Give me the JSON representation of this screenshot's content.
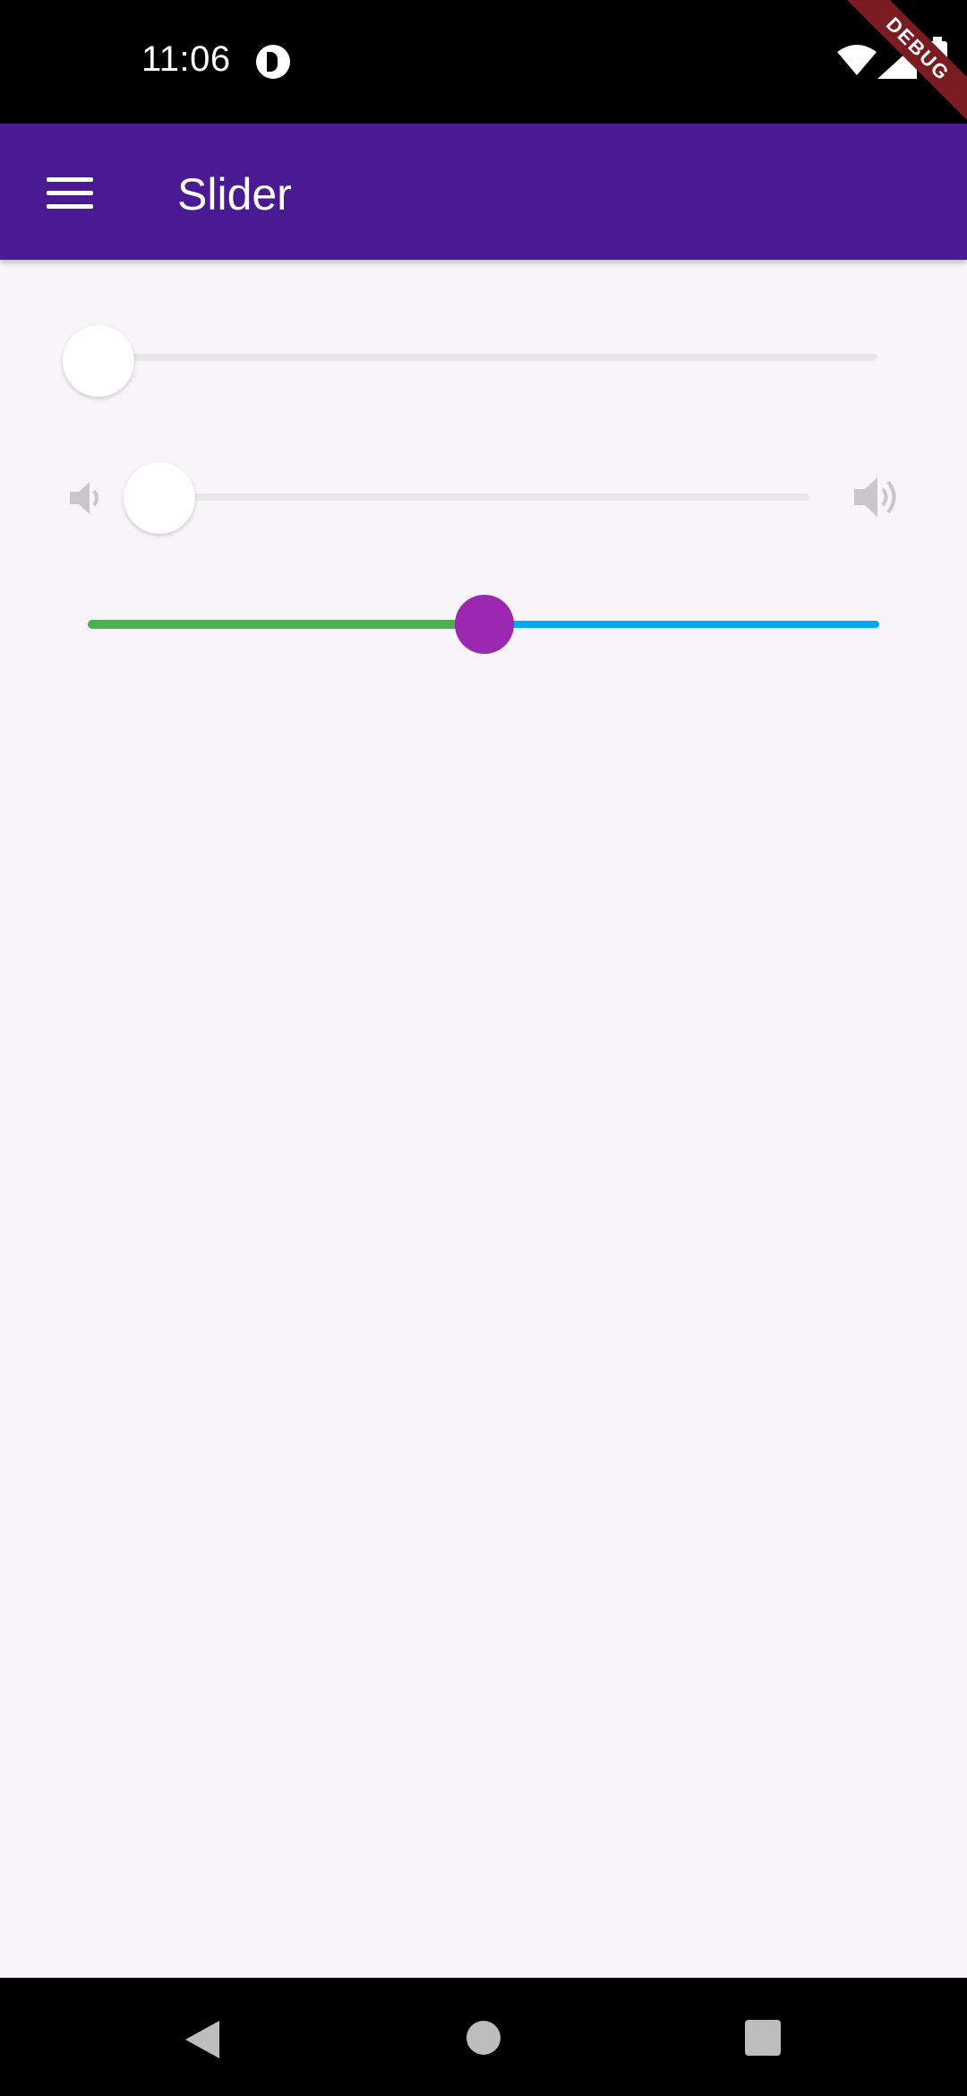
{
  "status_bar": {
    "time": "11:06",
    "debug_label": "DEBUG",
    "icons": [
      "app-notification-icon",
      "wifi-icon",
      "signal-icon",
      "battery-icon"
    ]
  },
  "app_bar": {
    "title": "Slider",
    "menu_icon": "menu-icon",
    "color": "#4a1a93"
  },
  "sliders": [
    {
      "name": "basic-slider",
      "value": 0.0,
      "min": 0,
      "max": 1
    },
    {
      "name": "volume-slider",
      "value": 0.0,
      "min": 0,
      "max": 1,
      "leading_icon": "volume-down-icon",
      "trailing_icon": "volume-up-icon"
    },
    {
      "name": "custom-slider",
      "value": 0.5,
      "min": 0,
      "max": 1,
      "active_color": "#4caf50",
      "inactive_color": "#03a9f4",
      "thumb_color": "#9c27b0"
    }
  ],
  "nav_bar": {
    "icons": [
      "back-icon",
      "home-icon",
      "recents-icon"
    ]
  }
}
